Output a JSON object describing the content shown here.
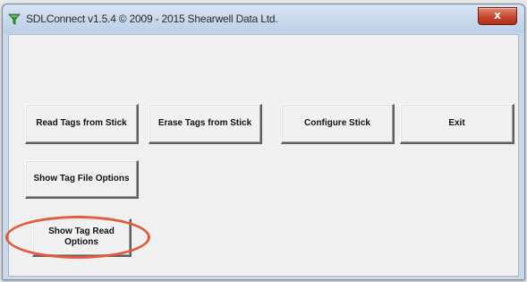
{
  "window": {
    "title": "SDLConnect v1.5.4 © 2009 - 2015 Shearwell Data Ltd.",
    "close_label": "x",
    "accent_close": "#c4442b",
    "titlebar_color": "#c9d9ea",
    "app_icon": "green-funnel-icon"
  },
  "buttons": {
    "read_tags": "Read Tags from Stick",
    "erase_tags": "Erase Tags from Stick",
    "configure": "Configure Stick",
    "exit": "Exit",
    "tag_file_options": "Show Tag File Options",
    "tag_read_options": "Show Tag Read Options"
  },
  "annotation": {
    "highlight_color": "#e45a3c",
    "highlighted": "tag_read_options"
  }
}
